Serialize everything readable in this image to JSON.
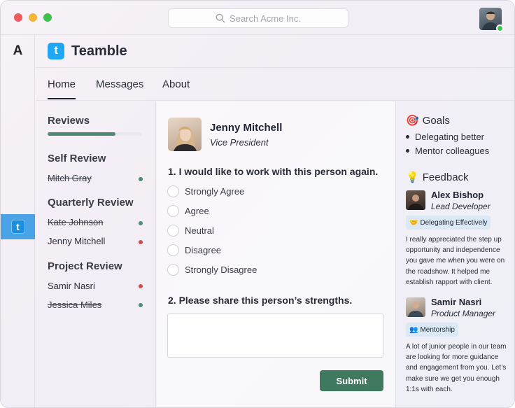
{
  "search": {
    "placeholder": "Search Acme Inc."
  },
  "rail": {
    "letter": "A",
    "app_letter": "t"
  },
  "app": {
    "logo_letter": "t",
    "name": "Teamble"
  },
  "nav": {
    "tabs": [
      {
        "label": "Home"
      },
      {
        "label": "Messages"
      },
      {
        "label": "About"
      }
    ]
  },
  "reviews": {
    "title": "Reviews",
    "progress": 0.72,
    "groups": [
      {
        "title": "Self Review",
        "people": [
          {
            "name": "Mitch Gray",
            "status": "done"
          }
        ]
      },
      {
        "title": "Quarterly Review",
        "people": [
          {
            "name": "Kate Johnson",
            "status": "done"
          },
          {
            "name": "Jenny Mitchell",
            "status": "pending"
          }
        ]
      },
      {
        "title": "Project Review",
        "people": [
          {
            "name": "Samir Nasri",
            "status": "pending"
          },
          {
            "name": "Jessica Miles",
            "status": "done"
          }
        ]
      }
    ]
  },
  "form": {
    "employee": {
      "name": "Jenny Mitchell",
      "role": "Vice President"
    },
    "q1": "1. I would like to work with this person again.",
    "options": [
      "Strongly Agree",
      "Agree",
      "Neutral",
      "Disagree",
      "Strongly Disagree"
    ],
    "q2": "2. Please share this person’s strengths.",
    "answer": "",
    "submit_label": "Submit"
  },
  "goals": {
    "icon": "🎯",
    "title": "Goals",
    "items": [
      "Delegating better",
      "Mentor colleagues"
    ]
  },
  "feedback": {
    "icon": "💡",
    "title": "Feedback",
    "items": [
      {
        "name": "Alex Bishop",
        "role": "Lead Developer",
        "tag_icon": "🤝",
        "tag": "Delegating Effectively",
        "text": "I really appreciated the step up opportunity and independence you gave me when you were on the roadshow. It helped me establish rapport with client."
      },
      {
        "name": "Samir Nasri",
        "role": "Product Manager",
        "tag_icon": "👥",
        "tag": "Mentorship",
        "text": "A lot of junior people in our team are looking for more guidance and engagement from you. Let’s make sure we get you enough 1:1s with each."
      }
    ]
  },
  "colors": {
    "accent": "#3f7a60",
    "brand": "#1fa7f3",
    "done": "#4e8a72",
    "pending": "#d24a4a"
  }
}
